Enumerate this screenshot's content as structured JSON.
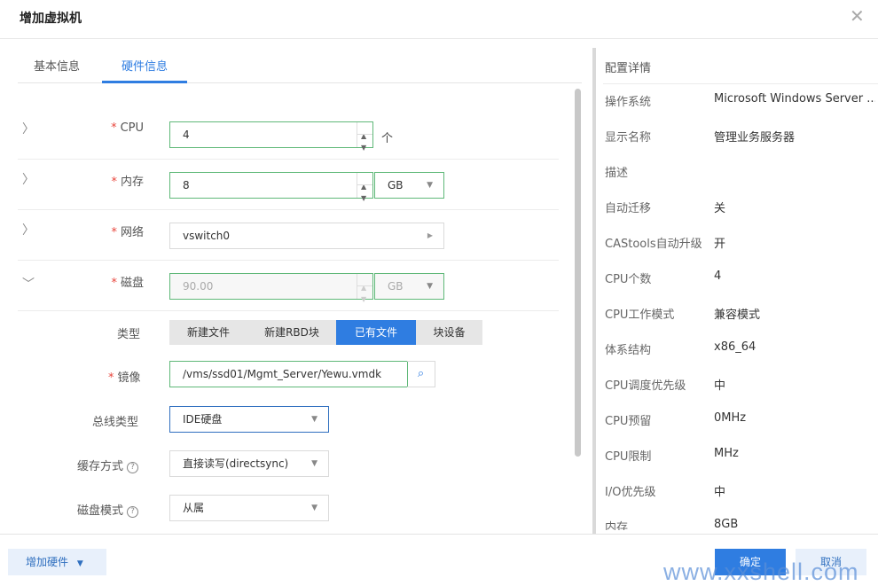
{
  "dialog": {
    "title": "增加虚拟机"
  },
  "tabs": [
    {
      "label": "基本信息"
    },
    {
      "label": "硬件信息"
    }
  ],
  "hardware": {
    "cpu": {
      "label": "CPU",
      "value": "4",
      "unit": "个"
    },
    "memory": {
      "label": "内存",
      "value": "8",
      "unit": "GB"
    },
    "network": {
      "label": "网络",
      "value": "vswitch0"
    },
    "disk": {
      "label": "磁盘",
      "value": "90.00",
      "unit": "GB",
      "type_label": "类型",
      "type_options": [
        "新建文件",
        "新建RBD块",
        "已有文件",
        "块设备"
      ],
      "type_selected": "已有文件",
      "image_label": "镜像",
      "image_value": "/vms/ssd01/Mgmt_Server/Yewu.vmdk",
      "bus_label": "总线类型",
      "bus_value": "IDE硬盘",
      "cache_label": "缓存方式",
      "cache_value": "直接读写(directsync)",
      "mode_label": "磁盘模式",
      "mode_value": "从属"
    }
  },
  "details": {
    "heading": "配置详情",
    "items": [
      {
        "k": "操作系统",
        "v": "Microsoft Windows Server ..."
      },
      {
        "k": "显示名称",
        "v": "管理业务服务器"
      },
      {
        "k": "描述",
        "v": ""
      },
      {
        "k": "自动迁移",
        "v": "关"
      },
      {
        "k": "CAStools自动升级",
        "v": "开"
      },
      {
        "k": "CPU个数",
        "v": "4"
      },
      {
        "k": "CPU工作模式",
        "v": "兼容模式"
      },
      {
        "k": "体系结构",
        "v": "x86_64"
      },
      {
        "k": "CPU调度优先级",
        "v": "中"
      },
      {
        "k": "CPU预留",
        "v": "0MHz"
      },
      {
        "k": "CPU限制",
        "v": "MHz"
      },
      {
        "k": "I/O优先级",
        "v": "中"
      },
      {
        "k": "内存",
        "v": "8GB"
      }
    ]
  },
  "footer": {
    "add_hardware": "增加硬件",
    "ok": "确定",
    "cancel": "取消"
  },
  "watermark": "www.xxshell.com",
  "colors": {
    "accent": "#2f7de1",
    "required": "#e8453c",
    "valid_border": "#5fb878"
  }
}
